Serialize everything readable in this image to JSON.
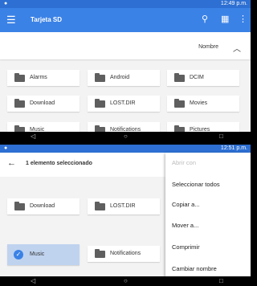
{
  "screen1": {
    "status_time": "12:49 p.m.",
    "appbar_title": "Tarjeta SD",
    "sort_label": "Nombre",
    "folders": [
      "Alarms",
      "Android",
      "DCIM",
      "Download",
      "LOST.DIR",
      "Movies",
      "Music",
      "Notifications",
      "Pictures"
    ]
  },
  "screen2": {
    "status_time": "12:51 p.m.",
    "selection_title": "1 elemento seleccionado",
    "folders": [
      "Download",
      "LOST.DIR",
      "Music",
      "Notifications"
    ],
    "menu": [
      "Abrir con",
      "Seleccionar todos",
      "Copiar a...",
      "Mover a...",
      "Comprimir",
      "Cambiar nombre"
    ]
  },
  "icons": {
    "menu": "hamburger-icon",
    "search": "search-icon",
    "view": "grid-view-icon",
    "more": "more-vert-icon",
    "back": "arrow-left-icon",
    "sort": "chevron-up-icon",
    "folder": "folder-icon",
    "check": "check-icon"
  },
  "colors": {
    "accent": "#3b82e6",
    "selected": "#bfd3ef"
  }
}
